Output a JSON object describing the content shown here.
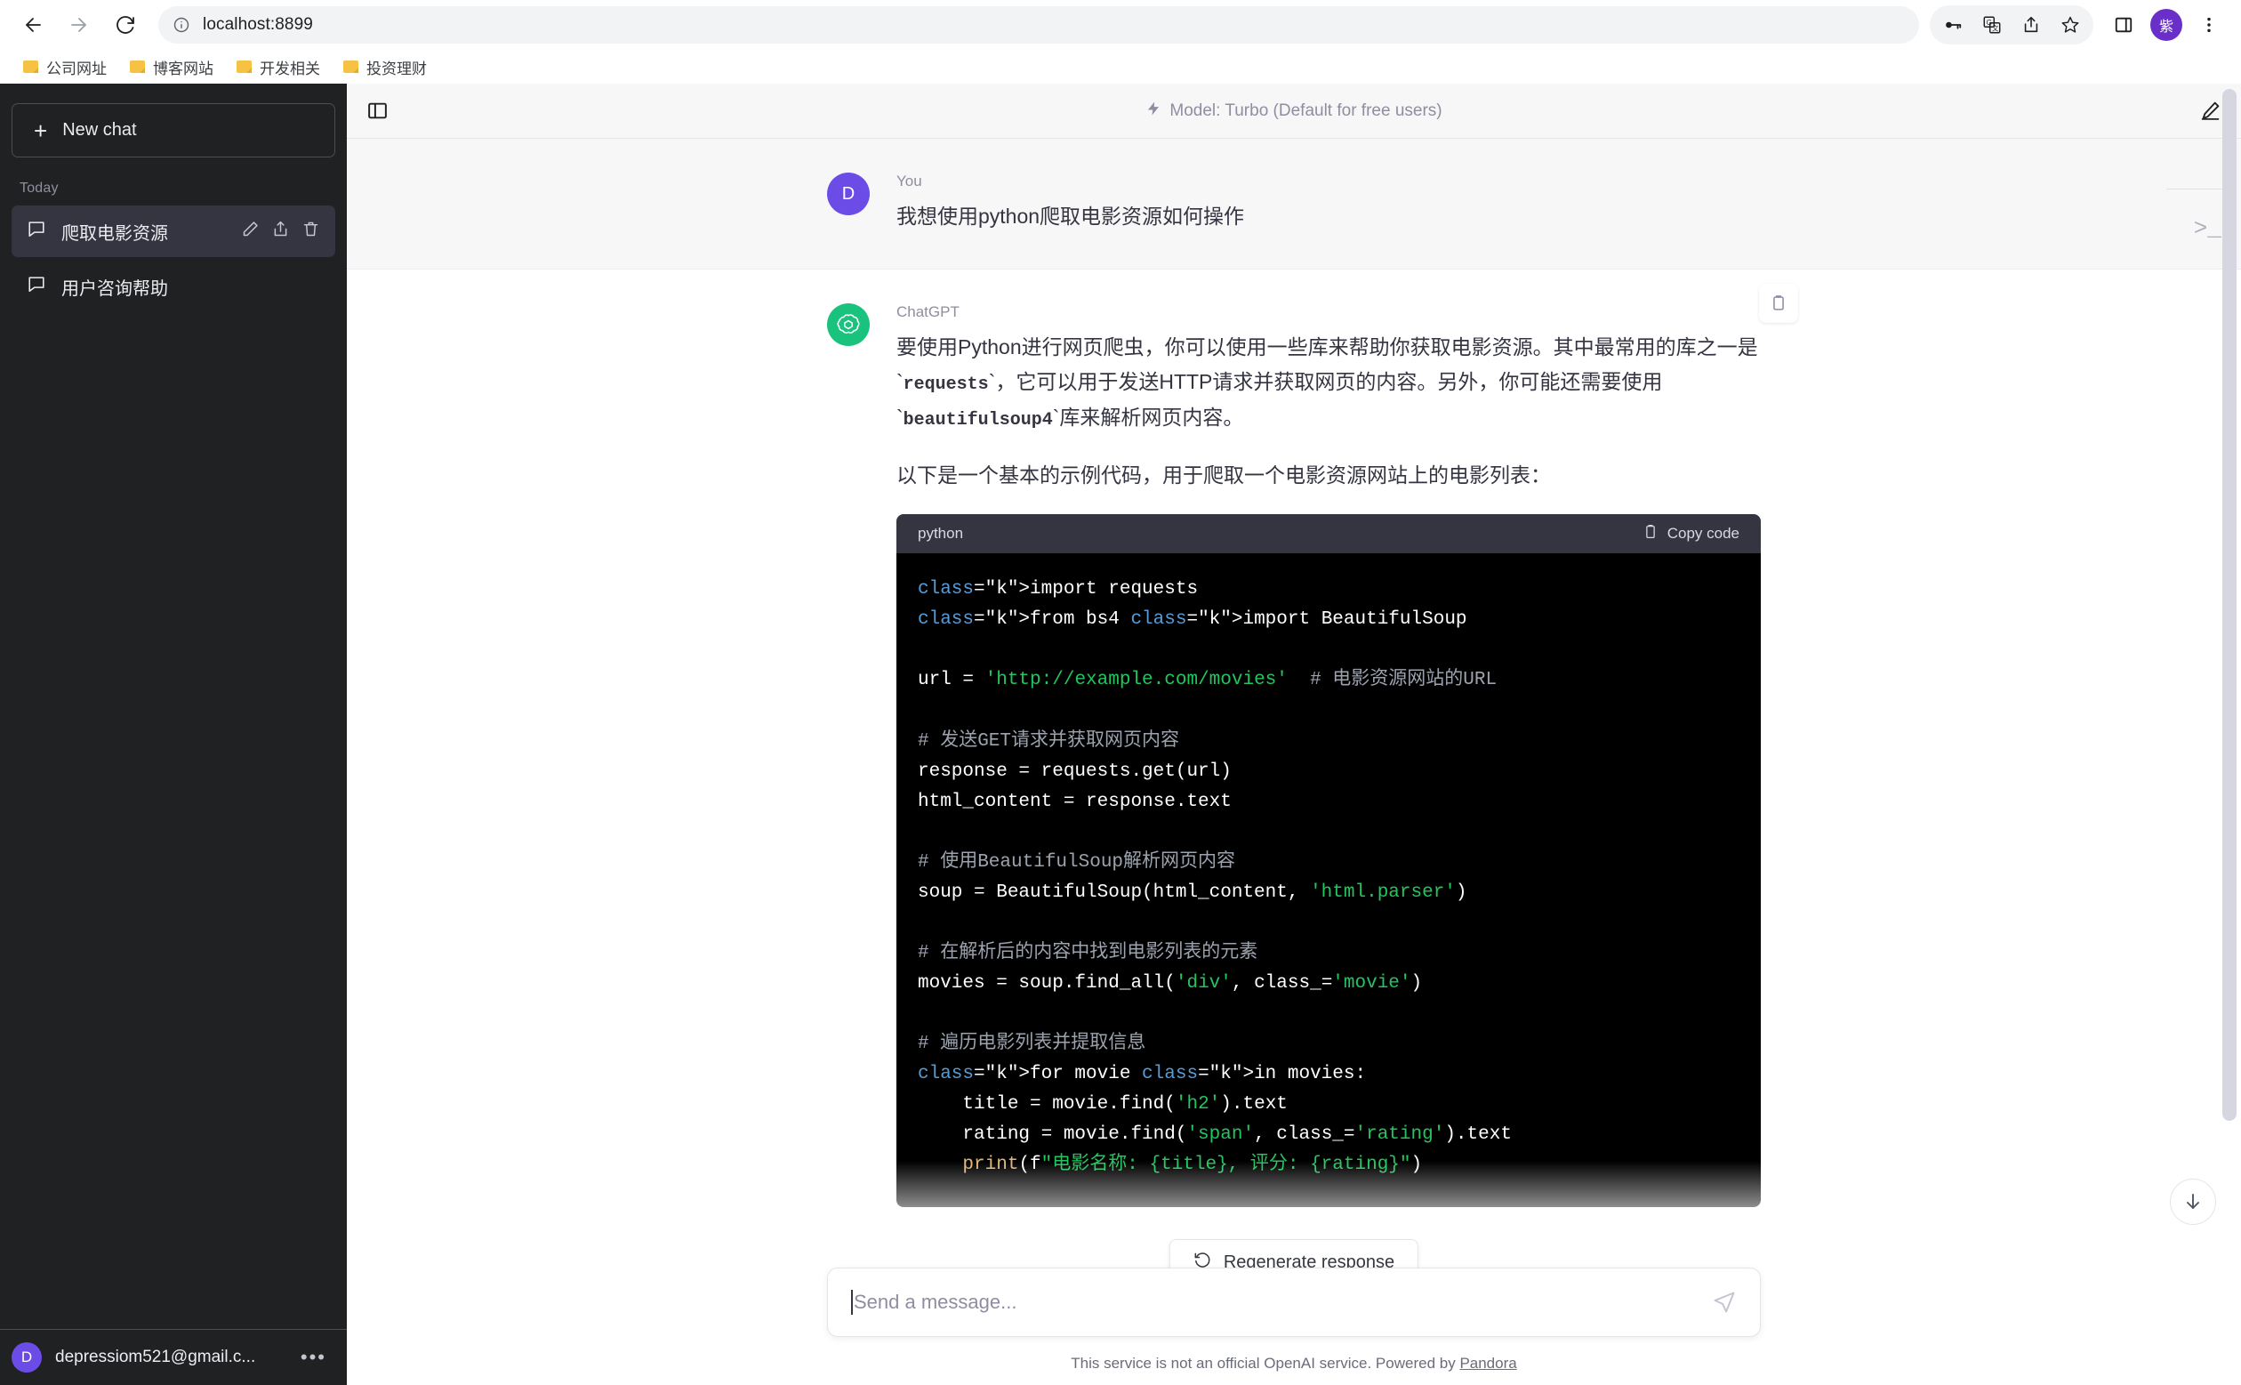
{
  "browser": {
    "back_icon": "back-arrow-icon",
    "forward_icon": "forward-arrow-icon",
    "reload_icon": "reload-icon",
    "info_icon": "site-info-icon",
    "url": "localhost:8899",
    "toolbar_icons": [
      "key-icon",
      "translate-icon",
      "share-icon",
      "bookmark-star-icon",
      "side-panel-icon",
      "profile-avatar",
      "more-menu-icon"
    ],
    "profile_initial": "紫",
    "bookmarks": [
      {
        "label": "公司网址"
      },
      {
        "label": "博客网站"
      },
      {
        "label": "开发相关"
      },
      {
        "label": "投资理财"
      }
    ]
  },
  "sidebar": {
    "new_chat_label": "New chat",
    "section_label": "Today",
    "chats": [
      {
        "title": "爬取电影资源",
        "active": true
      },
      {
        "title": "用户咨询帮助",
        "active": false
      }
    ],
    "chat_item_actions": [
      "edit-icon",
      "share-icon",
      "delete-icon"
    ],
    "account": {
      "initial": "D",
      "email": "depressiom521@gmail.c...",
      "more_label": "•••"
    }
  },
  "header": {
    "toggle_sidebar_icon": "panel-toggle-icon",
    "model_label": "Model: Turbo (Default for free users)",
    "bolt_icon": "bolt-icon",
    "new_chat_icon": "compose-icon"
  },
  "conversation": {
    "messages": [
      {
        "role": "You",
        "avatar": "D",
        "avatar_color": "#6b4ce6",
        "text": "我想使用python爬取电影资源如何操作"
      },
      {
        "role": "ChatGPT",
        "avatar_color": "#19c37d",
        "paragraph_1_a": "要使用Python进行网页爬虫，你可以使用一些库来帮助你获取电影资源。其中最常用的库之一是`",
        "paragraph_1_code1": "requests",
        "paragraph_1_b": "`，它可以用于发送HTTP请求并获取网页的内容。另外，你可能还需要使用`",
        "paragraph_1_code2": "beautifulsoup4",
        "paragraph_1_c": "`库来解析网页内容。",
        "paragraph_2": "以下是一个基本的示例代码，用于爬取一个电影资源网站上的电影列表：",
        "copy_icon": "clipboard-icon"
      }
    ],
    "code_block": {
      "language": "python",
      "copy_label": "Copy code",
      "copy_icon": "clipboard-icon",
      "lines": [
        "import requests",
        "from bs4 import BeautifulSoup",
        "",
        "url = 'http://example.com/movies'  # 电影资源网站的URL",
        "",
        "# 发送GET请求并获取网页内容",
        "response = requests.get(url)",
        "html_content = response.text",
        "",
        "# 使用BeautifulSoup解析网页内容",
        "soup = BeautifulSoup(html_content, 'html.parser')",
        "",
        "# 在解析后的内容中找到电影列表的元素",
        "movies = soup.find_all('div', class_='movie')",
        "",
        "# 遍历电影列表并提取信息",
        "for movie in movies:",
        "    title = movie.find('h2').text",
        "    rating = movie.find('span', class_='rating').text",
        "    print(f\"电影名称: {title}, 评分: {rating}\")"
      ]
    }
  },
  "regenerate": {
    "label": "Regenerate response",
    "icon": "refresh-icon"
  },
  "scroll_button": {
    "icon": "arrow-down-icon"
  },
  "right_rail": {
    "icon": "terminal-icon",
    "glyph": ">_"
  },
  "composer": {
    "placeholder": "Send a message...",
    "send_icon": "send-paperplane-icon",
    "footer_text_before": "This service is not an official OpenAI service. Powered by ",
    "footer_link": "Pandora"
  }
}
